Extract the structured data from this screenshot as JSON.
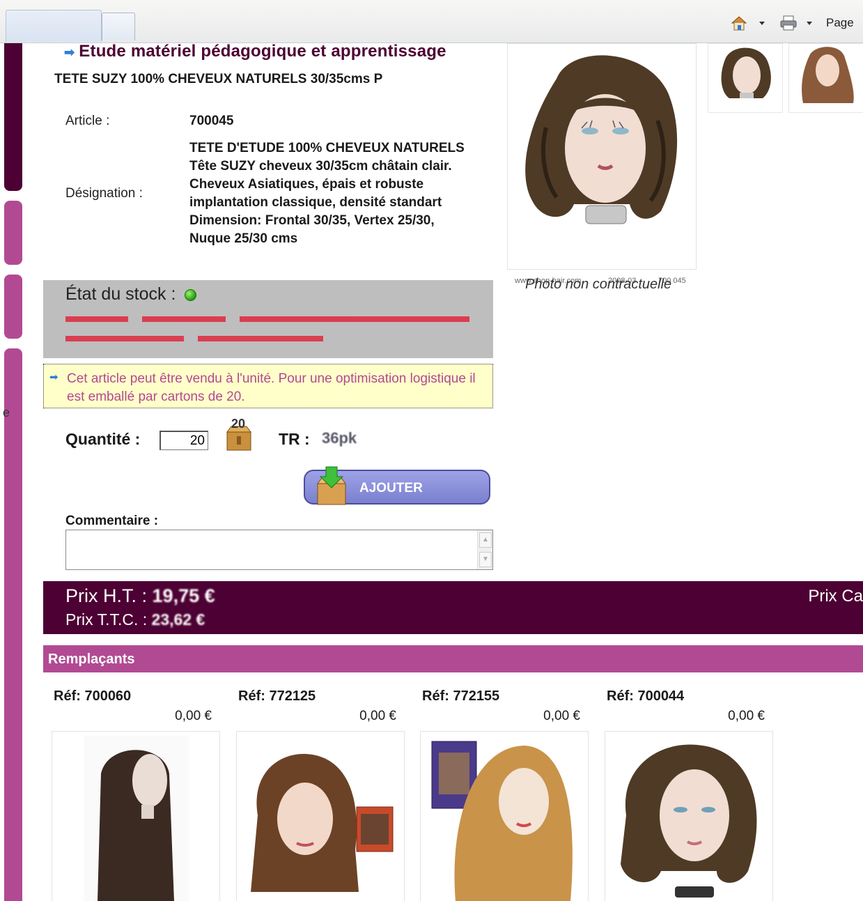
{
  "browser": {
    "page_menu_label": "Page"
  },
  "sidebar": {
    "letter": "e"
  },
  "product": {
    "section_title": "Etude matériel pédagogique et apprentissage",
    "name": "TETE SUZY 100% CHEVEUX NATURELS 30/35cms P",
    "article_label": "Article :",
    "article_value": "700045",
    "designation_label": "Désignation :",
    "designation_lines": [
      "TETE D'ETUDE 100% CHEVEUX NATURELS",
      "Tête SUZY cheveux 30/35cm châtain clair.",
      "Cheveux Asiatiques, épais et robuste",
      "implantation classique, densité standart",
      "Dimension: Frontal 30/35, Vertex 25/30,",
      "Nuque 25/30 cms"
    ],
    "photo_caption": {
      "site": "www.shop-hair.com",
      "date": "2008-03",
      "ref": "700 045"
    },
    "photo_note": "Photo non contractuelle"
  },
  "stock": {
    "label": "État du stock :",
    "status_color": "#2aa81a"
  },
  "info": {
    "text": "Cet article peut être vendu à l'unité. Pour une optimisation logistique il est emballé par cartons de 20."
  },
  "order": {
    "quantity_label": "Quantité :",
    "quantity_value": "20",
    "carton_count": "20",
    "tr_label": "TR :",
    "tr_value": "36pk",
    "add_button": "AJOUTER",
    "comment_label": "Commentaire :"
  },
  "prices": {
    "ht_label": "Prix H.T. :",
    "ht_value": "19,75 €",
    "ttc_label": "Prix T.T.C. :",
    "ttc_value": "23,62 €",
    "ca_label": "Prix Ca"
  },
  "replacements": {
    "title": "Remplaçants",
    "items": [
      {
        "ref": "Réf: 700060",
        "price": "0,00 €"
      },
      {
        "ref": "Réf: 772125",
        "price": "0,00 €"
      },
      {
        "ref": "Réf: 772155",
        "price": "0,00 €"
      },
      {
        "ref": "Réf: 700044",
        "price": "0,00 €"
      }
    ]
  },
  "colors": {
    "brand_dark": "#4d0033",
    "brand_pink": "#b24a93",
    "info_bg": "#ffffc9",
    "stock_bg": "#bebebe",
    "button": "#8a8fdc"
  }
}
